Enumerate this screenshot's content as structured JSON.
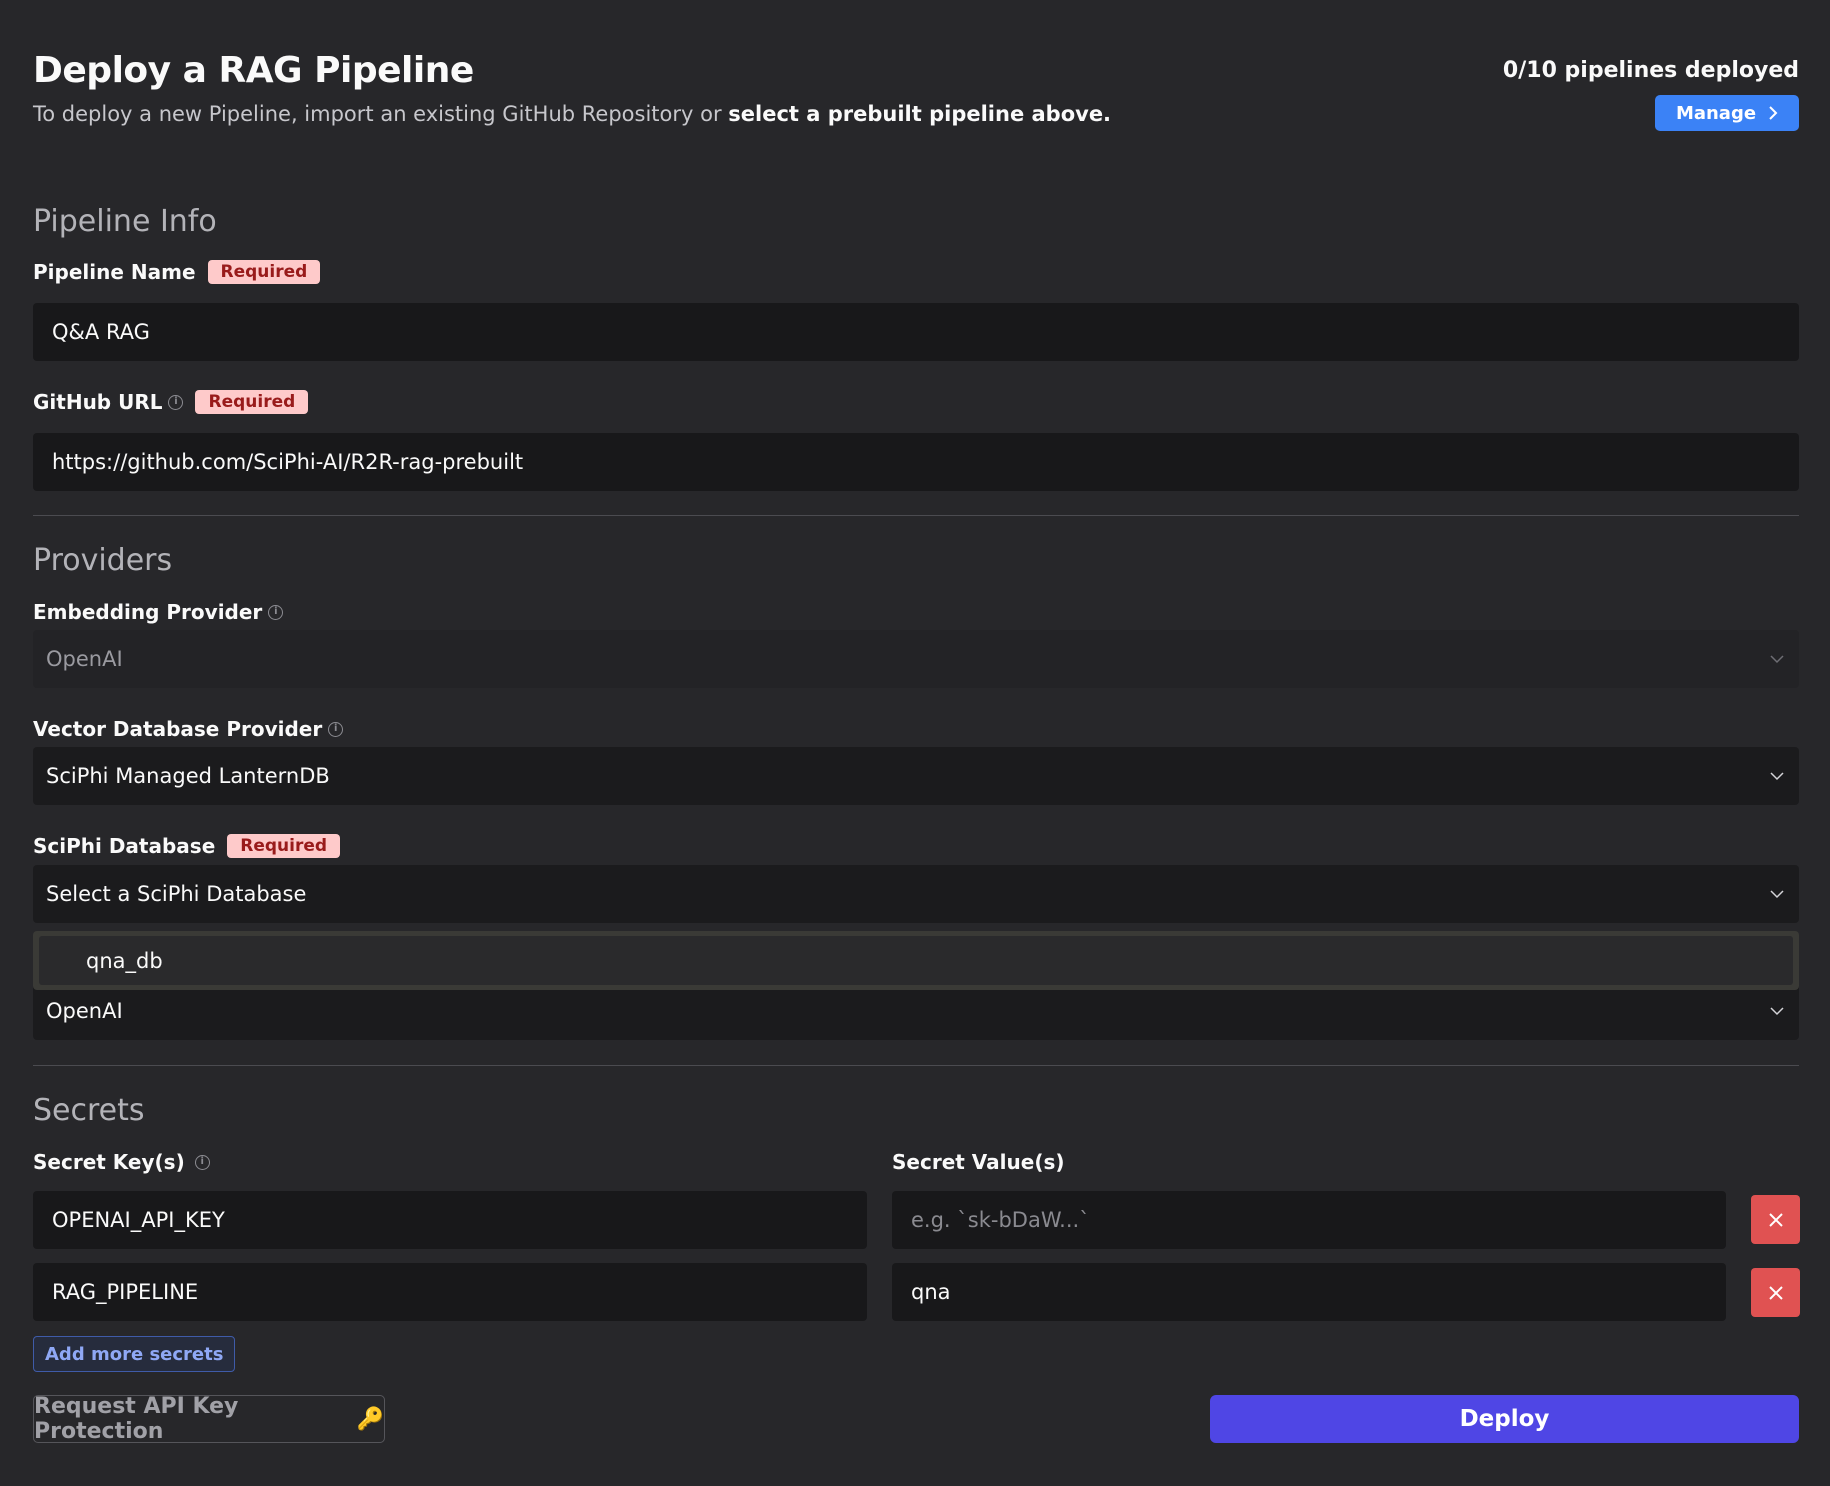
{
  "header": {
    "title": "Deploy a RAG Pipeline",
    "subtitle_plain": "To deploy a new Pipeline, import an existing GitHub Repository or ",
    "subtitle_bold": "select a prebuilt pipeline above.",
    "pipelines_count": "0/10 pipelines deployed",
    "manage_label": "Manage"
  },
  "pipeline_info": {
    "section_title": "Pipeline Info",
    "name_label": "Pipeline Name",
    "name_required": "Required",
    "name_value": "Q&A RAG",
    "github_label": "GitHub URL",
    "github_required": "Required",
    "github_value": "https://github.com/SciPhi-AI/R2R-rag-prebuilt"
  },
  "providers": {
    "section_title": "Providers",
    "embedding_label": "Embedding Provider",
    "embedding_value": "OpenAI",
    "vector_label": "Vector Database Provider",
    "vector_value": "SciPhi Managed LanternDB",
    "sciphi_db_label": "SciPhi Database",
    "sciphi_db_required": "Required",
    "sciphi_db_value": "Select a SciPhi Database",
    "sciphi_db_options": [
      "qna_db"
    ],
    "llm_value": "OpenAI"
  },
  "secrets": {
    "section_title": "Secrets",
    "key_label": "Secret Key(s)",
    "value_label": "Secret Value(s)",
    "rows": [
      {
        "key": "OPENAI_API_KEY",
        "value": "",
        "value_placeholder": "e.g. `sk-bDaW...`"
      },
      {
        "key": "RAG_PIPELINE",
        "value": "qna",
        "value_placeholder": ""
      }
    ],
    "add_label": "Add more secrets"
  },
  "footer": {
    "request_label": "Request API Key Protection",
    "request_icon": "🔑",
    "deploy_label": "Deploy"
  },
  "colors": {
    "background": "#27272a",
    "input_bg": "#18181a",
    "accent_blue": "#3b82f6",
    "deploy": "#4f46e5",
    "danger": "#e05252",
    "required_bg": "#fecaca",
    "required_text": "#991b1b"
  }
}
